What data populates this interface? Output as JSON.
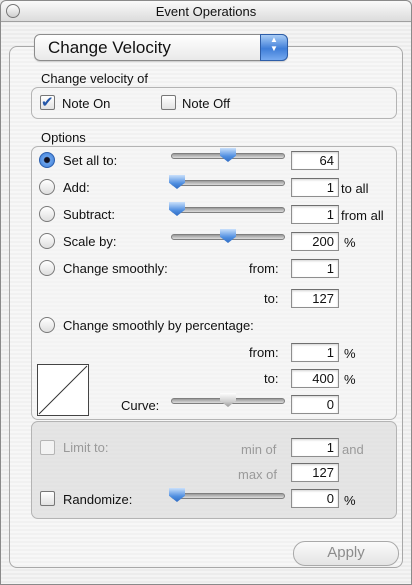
{
  "window": {
    "title": "Event Operations"
  },
  "operation": {
    "selected": "Change Velocity"
  },
  "change_velocity_of": {
    "label": "Change velocity of",
    "note_on": {
      "label": "Note On",
      "checked": true
    },
    "note_off": {
      "label": "Note Off",
      "checked": false
    }
  },
  "options": {
    "label": "Options",
    "set_all": {
      "label": "Set all to:",
      "value": "64",
      "selected": true
    },
    "add": {
      "label": "Add:",
      "value": "1",
      "suffix": "to all"
    },
    "subtract": {
      "label": "Subtract:",
      "value": "1",
      "suffix": "from all"
    },
    "scale": {
      "label": "Scale by:",
      "value": "200",
      "suffix": "%"
    },
    "smooth": {
      "label": "Change smoothly:",
      "from_label": "from:",
      "from_value": "1",
      "to_label": "to:",
      "to_value": "127"
    },
    "smooth_pct": {
      "label": "Change smoothly by percentage:",
      "from_label": "from:",
      "from_value": "1",
      "from_suffix": "%",
      "to_label": "to:",
      "to_value": "400",
      "to_suffix": "%"
    },
    "curve": {
      "label": "Curve:",
      "value": "0"
    }
  },
  "limit": {
    "label": "Limit to:",
    "min_label": "min of",
    "min_value": "1",
    "and_label": "and",
    "max_label": "max of",
    "max_value": "127"
  },
  "randomize": {
    "label": "Randomize:",
    "value": "0",
    "suffix": "%"
  },
  "apply_label": "Apply"
}
